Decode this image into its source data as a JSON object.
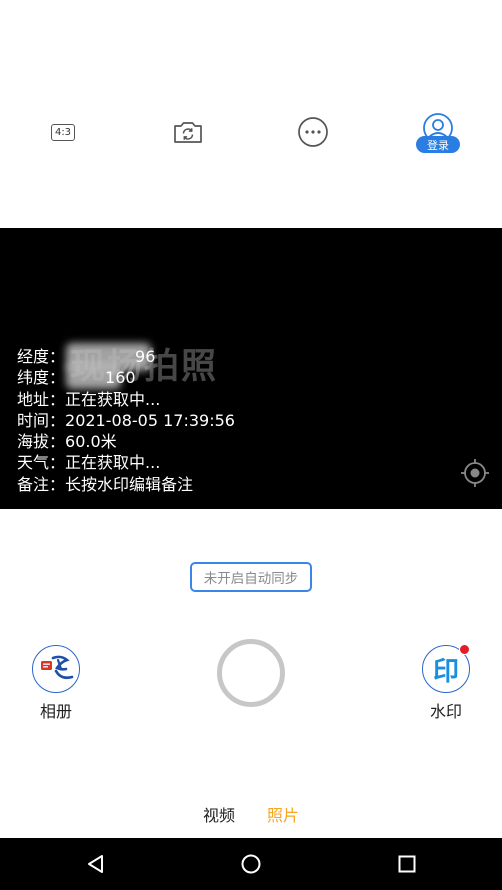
{
  "toolbar": {
    "ratio_label": "4:3",
    "login_label": "登录",
    "icons": [
      "ratio-icon",
      "camera-switch-icon",
      "more-icon",
      "user-icon"
    ]
  },
  "preview": {
    "watermark_title": "现场拍照",
    "info": {
      "longitude_label": "经度：",
      "longitude_value": "96",
      "latitude_label": "纬度：",
      "latitude_value": "160",
      "address_label": "地址：",
      "address_value": "正在获取中...",
      "time_label": "时间：",
      "time_value": "2021-08-05 17:39:56",
      "altitude_label": "海拔：",
      "altitude_value": "60.0米",
      "weather_label": "天气：",
      "weather_value": "正在获取中...",
      "note_label": "备注：",
      "note_value": "长按水印编辑备注"
    }
  },
  "sync_button": {
    "label": "未开启自动同步"
  },
  "album": {
    "label": "相册"
  },
  "watermark": {
    "label": "水印",
    "icon_text": "印"
  },
  "modes": {
    "video": "视频",
    "photo": "照片",
    "active": "photo"
  },
  "colors": {
    "accent": "#2a7de1",
    "active_mode": "#f5a623",
    "badge_dot": "#e31e2a"
  }
}
